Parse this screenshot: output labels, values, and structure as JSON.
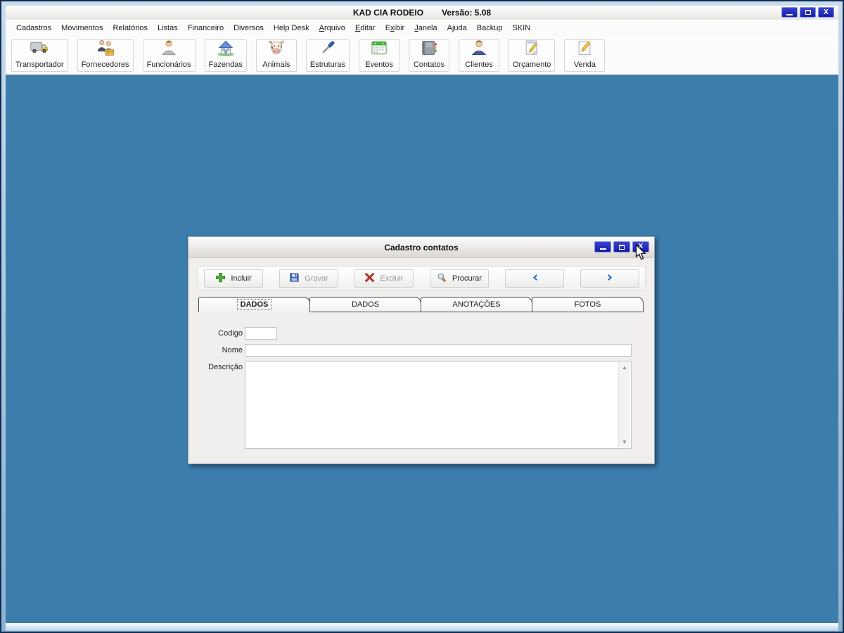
{
  "window": {
    "title": "KAD CIA RODEIO",
    "version": "Versão: 5.08",
    "close_glyph": "X"
  },
  "menu": {
    "items": [
      {
        "label": "Cadastros"
      },
      {
        "label": "Movimentos"
      },
      {
        "label": "Relatórios"
      },
      {
        "label": "Listas"
      },
      {
        "label": "Financeiro"
      },
      {
        "label": "Diversos"
      },
      {
        "label": "Help Desk"
      },
      {
        "label": "Arquivo",
        "accel": 0
      },
      {
        "label": "Editar",
        "accel": 0
      },
      {
        "label": "Exibir",
        "accel": 1
      },
      {
        "label": "Janela",
        "accel": 0
      },
      {
        "label": "Ajuda"
      },
      {
        "label": "Backup"
      },
      {
        "label": "SKIN"
      }
    ]
  },
  "toolbar": {
    "buttons": [
      {
        "label": "Transportador",
        "icon": "truck-icon"
      },
      {
        "label": "Fornecedores",
        "icon": "suppliers-icon"
      },
      {
        "label": "Funcionários",
        "icon": "employee-icon"
      },
      {
        "label": "Fazendas",
        "icon": "farm-icon"
      },
      {
        "label": "Animais",
        "icon": "cow-icon"
      },
      {
        "label": "Estruturas",
        "icon": "screwdriver-icon"
      },
      {
        "label": "Eventos",
        "icon": "calendar-icon"
      },
      {
        "label": "Contatos",
        "icon": "address-book-icon"
      },
      {
        "label": "Clientes",
        "icon": "client-icon"
      },
      {
        "label": "Orçamento",
        "icon": "budget-icon"
      },
      {
        "label": "Venda",
        "icon": "sale-icon"
      }
    ]
  },
  "dialog": {
    "title": "Cadastro contatos",
    "close_glyph": "X",
    "actions": [
      {
        "name": "incluir-button",
        "label": "Incluir",
        "icon": "plus-icon",
        "enabled": true
      },
      {
        "name": "gravar-button",
        "label": "Gravar",
        "icon": "save-icon",
        "enabled": false
      },
      {
        "name": "excluir-button",
        "label": "Excluir",
        "icon": "delete-icon",
        "enabled": false
      },
      {
        "name": "procurar-button",
        "label": "Procurar",
        "icon": "search-icon",
        "enabled": true
      },
      {
        "name": "previous-record-button",
        "label": "",
        "icon": "chevron-left-icon",
        "enabled": true
      },
      {
        "name": "next-record-button",
        "label": "",
        "icon": "chevron-right-icon",
        "enabled": true
      }
    ],
    "tabs": [
      {
        "label": "DADOS",
        "active": true
      },
      {
        "label": "DADOS",
        "active": false
      },
      {
        "label": "ANOTAÇÕES",
        "active": false
      },
      {
        "label": "FOTOS",
        "active": false
      }
    ],
    "fields": {
      "codigo": {
        "label": "Codigo",
        "value": ""
      },
      "nome": {
        "label": "Nome",
        "value": ""
      },
      "descricao": {
        "label": "Descrição",
        "value": ""
      }
    },
    "scrollbar": {
      "up_glyph": "▲",
      "down_glyph": "▼"
    }
  },
  "colors": {
    "mdi_background": "#3d7dab",
    "window_border_navy": "#0e2c55",
    "control_button_navy": "#161da5",
    "accent_blue": "#1d6cc0"
  }
}
